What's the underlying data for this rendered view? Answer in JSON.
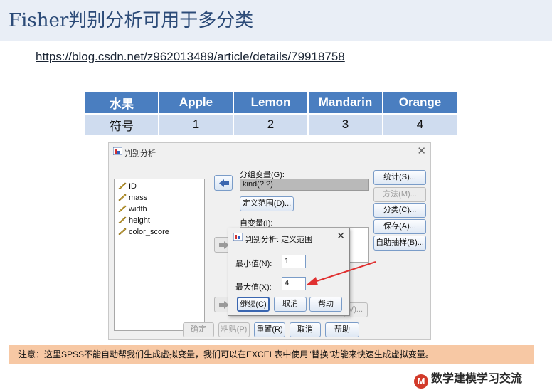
{
  "title": "Fisher判别分析可用于多分类",
  "url": "https://blog.csdn.net/z962013489/article/details/79918758",
  "table": {
    "headers": [
      "水果",
      "Apple",
      "Lemon",
      "Mandarin",
      "Orange"
    ],
    "row": [
      "符号",
      "1",
      "2",
      "3",
      "4"
    ],
    "header_color": "#4a7ec0",
    "row_color": "#cfdcef"
  },
  "dialog": {
    "title": "判别分析",
    "variables": [
      "ID",
      "mass",
      "width",
      "height",
      "color_score"
    ],
    "group_label": "分组变量(G):",
    "group_value": "kind(? ?)",
    "define_range": "定义范围(D)...",
    "indep_label": "自变量(I):",
    "side_buttons": {
      "statistics": "统计(S)...",
      "method": "方法(M)...",
      "classify": "分类(C)...",
      "save": "保存(A)...",
      "bootstrap": "自助抽样(B)..."
    },
    "bottom_buttons": {
      "ok": "确定",
      "paste": "粘贴(P)",
      "reset": "重置(R)",
      "cancel": "取消",
      "help": "帮助"
    },
    "partial_button": "V)..."
  },
  "subdialog": {
    "title": "判别分析: 定义范围",
    "min_label": "最小值(N):",
    "min_value": "1",
    "max_label": "最大值(X):",
    "max_value": "4",
    "continue": "继续(C)",
    "cancel": "取消",
    "help": "帮助"
  },
  "note": "注意：这里SPSS不能自动帮我们生成虚拟变量，我们可以在EXCEL表中使用\"替换\"功能来快速生成虚拟变量。",
  "watermark": "数学建模学习交流",
  "watermark_logo": "M",
  "colors": {
    "title": "#2c4b78",
    "note_bg": "#f7c8a4",
    "arrow": "#e03030"
  }
}
